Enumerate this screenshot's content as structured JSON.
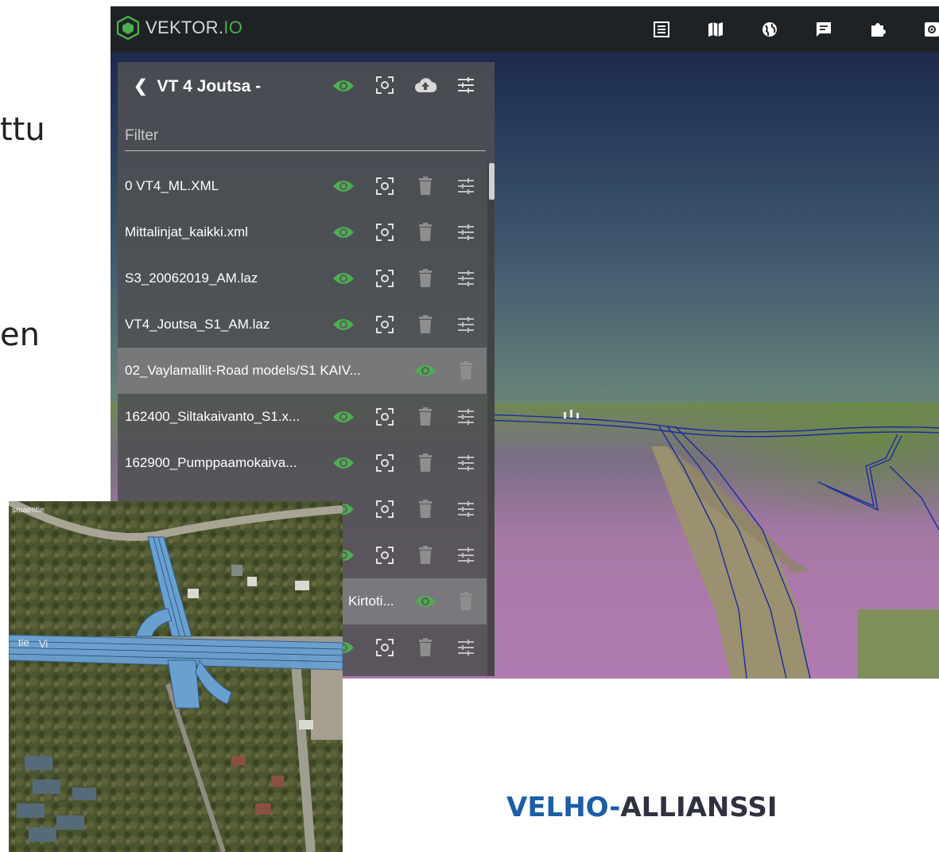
{
  "slide": {
    "fragment_1": "ttu",
    "fragment_2": "en",
    "brand_prefix": "VELHO-",
    "brand_suffix": "ALLIANSSI"
  },
  "app": {
    "logo_main": "VEKTOR.",
    "logo_accent": "IO",
    "toolbar_icons": [
      "table-list-icon",
      "map-icon",
      "globe-icon",
      "comment-icon",
      "puzzle-icon",
      "settings-icon"
    ]
  },
  "panel": {
    "project_title": "VT 4 Joutsa -",
    "filter_placeholder": "Filter",
    "layers": [
      {
        "label": "0 VT4_ML.XML",
        "type": "file"
      },
      {
        "label": "Mittalinjat_kaikki.xml",
        "type": "file"
      },
      {
        "label": "S3_20062019_AM.laz",
        "type": "file"
      },
      {
        "label": "VT4_Joutsa_S1_AM.laz",
        "type": "file"
      },
      {
        "label": "02_Vaylamallit-Road models/S1 KAIV...",
        "type": "group"
      },
      {
        "label": "162400_Siltakaivanto_S1.x...",
        "type": "file"
      },
      {
        "label": "162900_Pumppaamokaiva...",
        "type": "file"
      },
      {
        "label": "",
        "type": "file"
      },
      {
        "label": "",
        "type": "file"
      },
      {
        "label": "Kirtoti...",
        "type": "group"
      },
      {
        "label": "",
        "type": "file"
      }
    ]
  },
  "colors": {
    "accent_green": "#4caf50",
    "topbar": "#1f2224",
    "panel": "#4e5052",
    "brand_blue": "#1b5ea8"
  },
  "map": {
    "labels": [
      "smaentie",
      "tie",
      "Vi"
    ]
  }
}
